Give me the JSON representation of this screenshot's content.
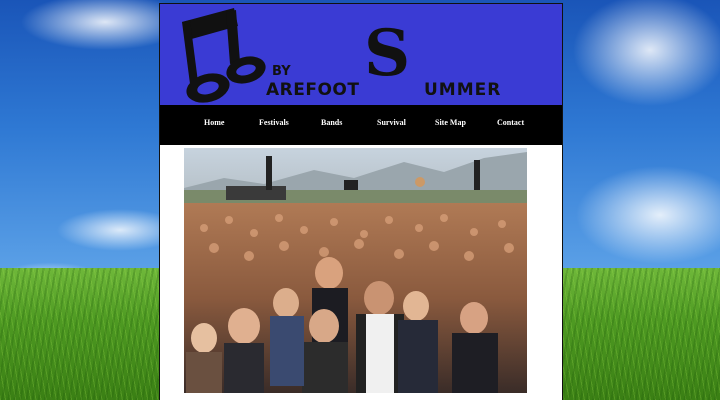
{
  "site": {
    "logo": {
      "by": "BY",
      "barefoot": "ArEFOOT",
      "s": "S",
      "ummer": "UMMER"
    }
  },
  "nav": {
    "items": [
      {
        "label": "Home"
      },
      {
        "label": "Festivals"
      },
      {
        "label": "Bands"
      },
      {
        "label": "Survival"
      },
      {
        "label": "Site Map"
      },
      {
        "label": "Contact"
      }
    ]
  },
  "colors": {
    "banner": "#3a3bd4",
    "nav": "#000000",
    "page": "#ffffff"
  },
  "icons": [
    "music-note-icon"
  ]
}
